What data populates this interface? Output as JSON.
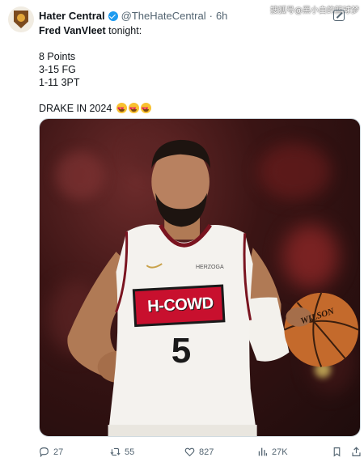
{
  "watermark": "搜狐号@黑小白的篮球梦",
  "author": {
    "display_name": "Hater Central",
    "handle": "@TheHateCentral",
    "separator": "·",
    "time": "6h"
  },
  "tweet": {
    "line1_bold": "Fred VanVleet",
    "line1_rest": " tonight:",
    "stats": [
      "8 Points",
      "3-15 FG",
      "1-11 3PT"
    ],
    "closing": "DRAKE IN 2024"
  },
  "media": {
    "jersey_wordmark": "H-COWD",
    "jersey_number": "5",
    "ball_text": "WILSON",
    "jersey_tag": "HERZOGA"
  },
  "actions": {
    "replies": "27",
    "reposts": "55",
    "likes": "827",
    "views": "27K"
  },
  "colors": {
    "accent": "#1d9bf0",
    "muted": "#536471",
    "jersey_red": "#c8102e"
  }
}
